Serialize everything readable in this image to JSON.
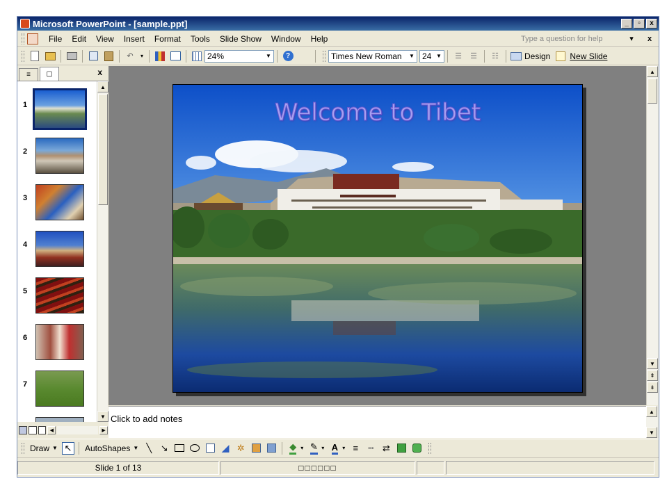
{
  "window": {
    "title": "Microsoft PowerPoint - [sample.ppt]",
    "controls": {
      "minimize": "_",
      "restore": "▫",
      "close": "x"
    }
  },
  "menu": {
    "items": [
      "File",
      "Edit",
      "View",
      "Insert",
      "Format",
      "Tools",
      "Slide Show",
      "Window",
      "Help"
    ],
    "help_placeholder": "Type a question for help",
    "help_dropdown": "▾",
    "close_doc": "x"
  },
  "toolbar": {
    "zoom": "24%",
    "font_name": "Times New Roman",
    "font_size": "24",
    "design_label": "Design",
    "new_slide_label": "New Slide"
  },
  "left_pane": {
    "tab_outline_icon": "≡",
    "tab_slides_icon": "▢",
    "close": "x",
    "thumbnails": [
      {
        "number": "1",
        "selected": true
      },
      {
        "number": "2",
        "selected": false
      },
      {
        "number": "3",
        "selected": false
      },
      {
        "number": "4",
        "selected": false
      },
      {
        "number": "5",
        "selected": false
      },
      {
        "number": "6",
        "selected": false
      },
      {
        "number": "7",
        "selected": false
      }
    ]
  },
  "slide": {
    "title": "Welcome to Tibet"
  },
  "notes": {
    "placeholder": "Click to add notes"
  },
  "draw_toolbar": {
    "draw_label": "Draw",
    "autoshapes_label": "AutoShapes"
  },
  "status": {
    "slide_position": "Slide 1 of 13",
    "design_indicator": "□□□□□□"
  },
  "colors": {
    "title_bar": "#0a246a",
    "chrome": "#ece9d8",
    "slide_bg": "#808080",
    "slide_title": "#a8a0f0"
  },
  "icons": [
    "app-icon",
    "new-icon",
    "open-icon",
    "print-icon",
    "copy-icon",
    "paste-icon",
    "undo-icon",
    "chart-icon",
    "table-icon",
    "grid-icon",
    "help-icon",
    "numbering-icon",
    "bullets-icon",
    "indent-icon",
    "design-icon",
    "new-slide-icon",
    "select-cursor-icon",
    "line-icon",
    "arrow-icon",
    "rectangle-icon",
    "oval-icon",
    "textbox-icon",
    "wordart-icon",
    "diagram-icon",
    "clipart-icon",
    "picture-icon",
    "fill-color-icon",
    "line-color-icon",
    "font-color-icon",
    "line-style-icon",
    "dash-style-icon",
    "arrow-style-icon",
    "shadow-icon",
    "3d-icon"
  ]
}
